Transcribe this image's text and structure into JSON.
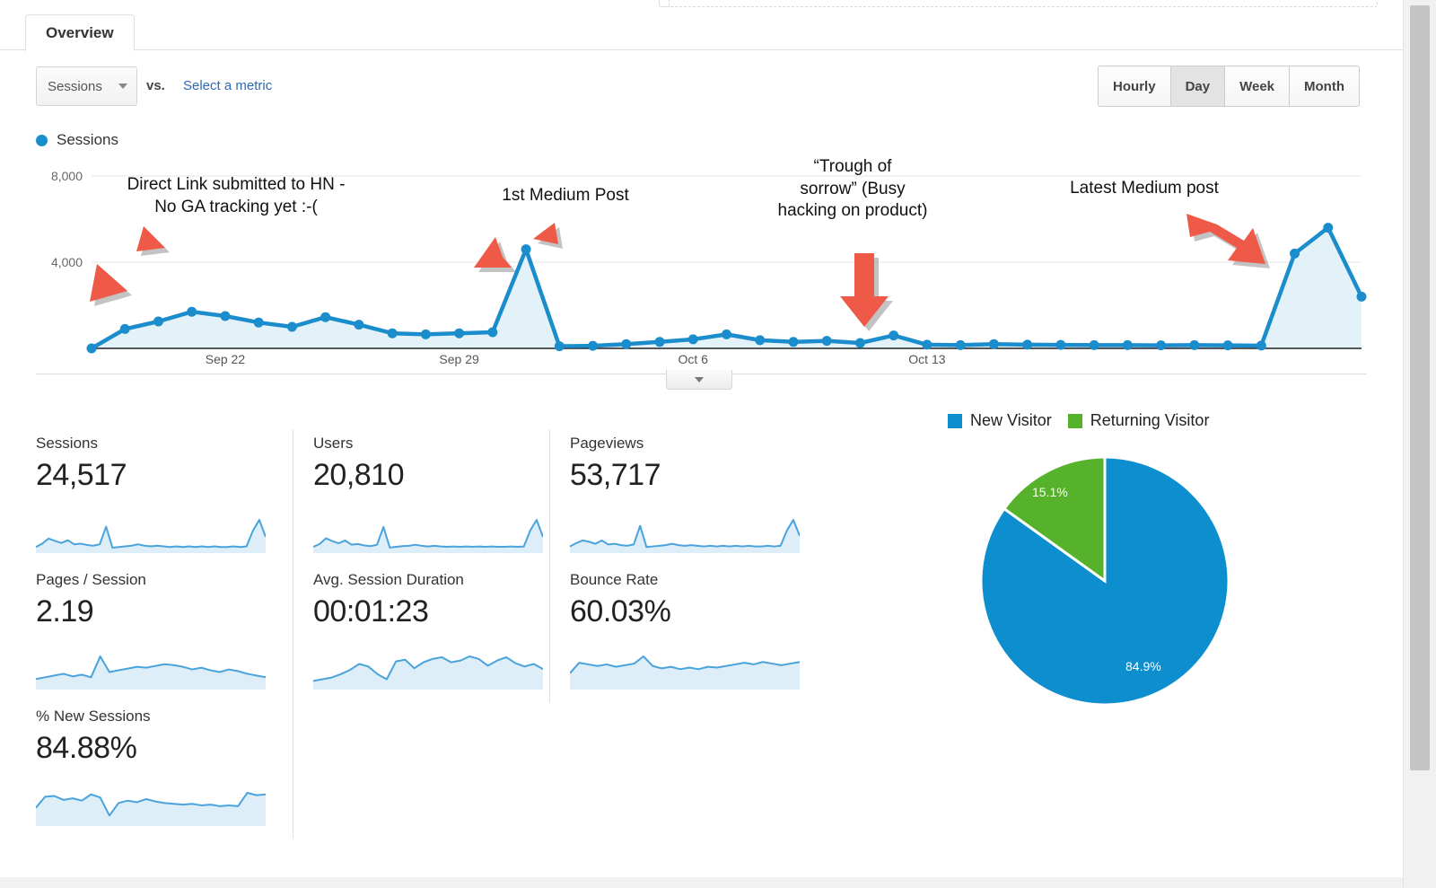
{
  "tab": {
    "label": "Overview"
  },
  "metric_selector": {
    "selected": "Sessions",
    "vs_label": "vs.",
    "compare_link": "Select a metric"
  },
  "granularity": {
    "options": [
      "Hourly",
      "Day",
      "Week",
      "Month"
    ],
    "selected": "Day"
  },
  "chart_legend": {
    "label": "Sessions"
  },
  "colors": {
    "series_blue": "#1b8dcc",
    "area_fill": "#e3f1f9",
    "new_visitor": "#0d8ecf",
    "returning_visitor": "#55b22a",
    "arrow_red": "#ee5a47",
    "link_blue": "#2f6bb0"
  },
  "annotations": [
    {
      "text": "Direct Link submitted to HN -\nNo GA tracking yet :-("
    },
    {
      "text": "1st Medium Post"
    },
    {
      "text": "“Trough of\nsorrow” (Busy\nhacking on product)"
    },
    {
      "text": "Latest Medium post"
    }
  ],
  "metrics": [
    {
      "label": "Sessions",
      "value": "24,517"
    },
    {
      "label": "Users",
      "value": "20,810"
    },
    {
      "label": "Pageviews",
      "value": "53,717"
    },
    {
      "label": "Pages / Session",
      "value": "2.19"
    },
    {
      "label": "Avg. Session Duration",
      "value": "00:01:23"
    },
    {
      "label": "Bounce Rate",
      "value": "60.03%"
    },
    {
      "label": "% New Sessions",
      "value": "84.88%"
    }
  ],
  "pie": {
    "legend": [
      {
        "label": "New Visitor",
        "color": "#0d8ecf"
      },
      {
        "label": "Returning Visitor",
        "color": "#55b22a"
      }
    ],
    "slice_labels": {
      "new": "84.9%",
      "returning": "15.1%"
    }
  },
  "chart_data": {
    "type": "area",
    "title": "Sessions",
    "xlabel": "",
    "ylabel": "Sessions",
    "ylim": [
      0,
      8000
    ],
    "yticks": [
      4000,
      8000
    ],
    "ytick_labels": [
      "4,000",
      "8,000"
    ],
    "xtick_labels": [
      "Sep 22",
      "Sep 29",
      "Oct 6",
      "Oct 13"
    ],
    "xtick_indices": [
      4,
      11,
      18,
      25
    ],
    "grid": true,
    "legend_position": "top-left",
    "series": [
      {
        "name": "Sessions",
        "values": [
          0,
          900,
          1250,
          1700,
          1500,
          1200,
          1000,
          1450,
          1100,
          700,
          650,
          700,
          750,
          4600,
          100,
          120,
          200,
          300,
          420,
          650,
          380,
          300,
          350,
          250,
          600,
          170,
          150,
          200,
          170,
          160,
          150,
          150,
          140,
          150,
          140,
          130,
          4400,
          5600,
          2400
        ]
      }
    ],
    "pie_chart": {
      "type": "pie",
      "title": "New vs Returning Visitors",
      "labels": [
        "New Visitor",
        "Returning Visitor"
      ],
      "values": [
        84.9,
        15.1
      ],
      "colors": [
        "#0d8ecf",
        "#55b22a"
      ],
      "legend_position": "top"
    },
    "sparklines": {
      "Sessions": [
        10,
        20,
        35,
        28,
        22,
        30,
        18,
        20,
        16,
        14,
        18,
        70,
        8,
        10,
        12,
        14,
        18,
        14,
        12,
        14,
        12,
        10,
        12,
        10,
        12,
        10,
        12,
        10,
        12,
        10,
        10,
        12,
        10,
        12,
        58,
        90,
        40
      ],
      "Users": [
        10,
        18,
        34,
        26,
        20,
        28,
        16,
        18,
        14,
        12,
        16,
        66,
        8,
        10,
        12,
        13,
        16,
        13,
        11,
        13,
        11,
        10,
        11,
        10,
        11,
        10,
        11,
        10,
        11,
        10,
        10,
        11,
        10,
        11,
        56,
        86,
        38
      ],
      "Pageviews": [
        12,
        22,
        30,
        26,
        20,
        30,
        18,
        20,
        16,
        14,
        18,
        74,
        10,
        12,
        14,
        16,
        20,
        16,
        14,
        16,
        14,
        12,
        14,
        12,
        14,
        12,
        14,
        12,
        14,
        12,
        12,
        14,
        12,
        14,
        60,
        92,
        44
      ],
      "Pages / Session": [
        18,
        22,
        26,
        30,
        24,
        28,
        22,
        70,
        34,
        38,
        42,
        46,
        44,
        48,
        52,
        50,
        46,
        40,
        44,
        38,
        34,
        40,
        36,
        30,
        26,
        22
      ],
      "Avg. Session Duration": [
        14,
        18,
        22,
        30,
        40,
        54,
        48,
        30,
        18,
        60,
        64,
        44,
        58,
        66,
        70,
        58,
        62,
        72,
        66,
        50,
        62,
        70,
        56,
        48,
        54,
        42
      ],
      "Bounce Rate": [
        34,
        60,
        56,
        52,
        56,
        50,
        54,
        58,
        76,
        52,
        46,
        50,
        44,
        48,
        44,
        50,
        48,
        52,
        56,
        60,
        56,
        62,
        58,
        54,
        58,
        62
      ],
      "% New Sessions": [
        40,
        68,
        70,
        60,
        64,
        58,
        74,
        66,
        20,
        52,
        58,
        54,
        62,
        56,
        52,
        50,
        48,
        50,
        46,
        48,
        44,
        46,
        44,
        78,
        72,
        74
      ]
    }
  }
}
